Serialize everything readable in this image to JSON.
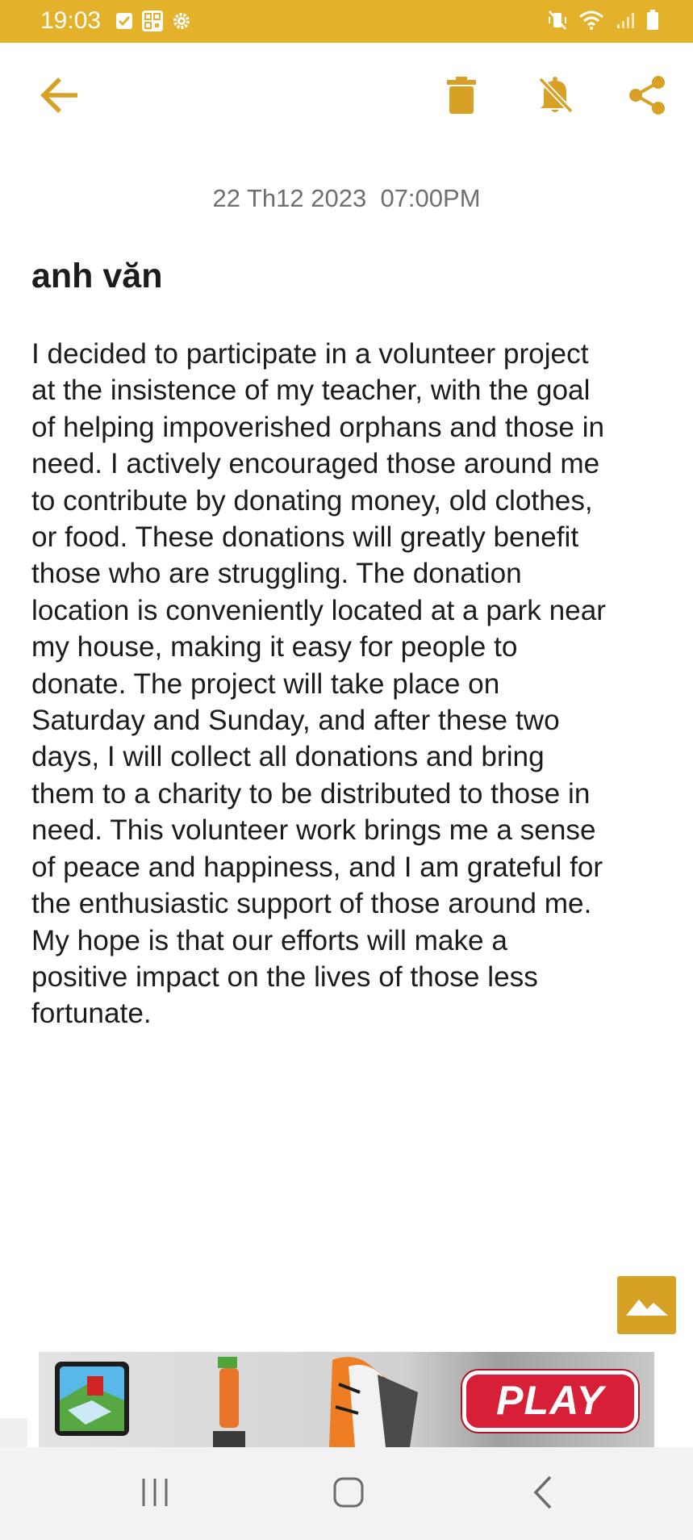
{
  "status_bar": {
    "time": "19:03",
    "left_icons": [
      "checkbox-notification-icon",
      "qr-code-icon",
      "settings-gear-icon"
    ],
    "right_icons": [
      "vibrate-mute-icon",
      "wifi-icon",
      "signal-icon",
      "battery-icon"
    ],
    "background": "#e3b12a"
  },
  "toolbar": {
    "icons": [
      "back-arrow-icon",
      "trash-icon",
      "bell-off-icon",
      "share-icon"
    ],
    "accent": "#d7a126"
  },
  "note": {
    "date": "22 Th12 2023  07:00PM",
    "title": "anh văn",
    "body_lines": [
      "I decided to participate in a volunteer project",
      "at the insistence of my teacher, with the goal",
      "of helping impoverished orphans and those in",
      "need. I actively encouraged those around me",
      "to contribute by donating money, old clothes,",
      "or food. These donations will greatly benefit",
      "those who are struggling. The donation",
      "location is conveniently located at a park near",
      "my house, making it easy for people to",
      "donate. The project will take place on",
      "Saturday and Sunday, and after these two",
      "days, I will collect all donations and bring",
      "them to a charity to be distributed to those in",
      "need. This volunteer work brings me a sense",
      "of peace and happiness, and I am grateful for",
      "the enthusiastic support of those around me.",
      "My hope is that our efforts will make a",
      "positive impact on the lives of those less",
      "fortunate."
    ]
  },
  "image_button": {
    "icon": "image-landscape-icon"
  },
  "ad": {
    "play_label": "PLAY"
  },
  "nav_bar": {
    "icons": [
      "recent-apps-icon",
      "home-icon",
      "back-chevron-icon"
    ]
  }
}
